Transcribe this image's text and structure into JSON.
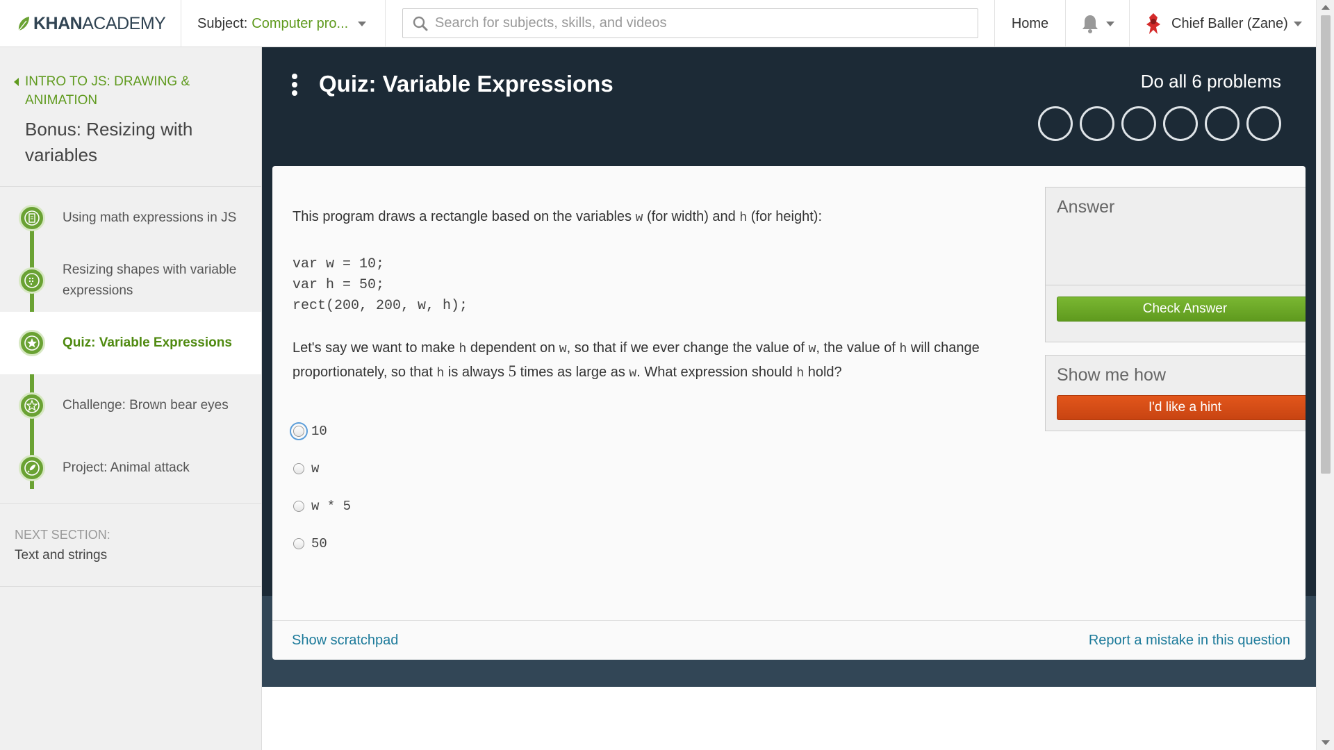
{
  "topbar": {
    "logo_bold": "KHAN",
    "logo_light": "ACADEMY",
    "subject_label": "Subject:",
    "subject_value": "Computer pro...",
    "search_placeholder": "Search for subjects, skills, and videos",
    "home": "Home",
    "user_name": "Chief Baller (Zane)"
  },
  "sidebar": {
    "back_label": "INTRO TO JS: DRAWING & ANIMATION",
    "tutorial_title": "Bonus: Resizing with variables",
    "steps": [
      {
        "label": "Using math expressions in JS",
        "icon": "article-icon"
      },
      {
        "label": "Resizing shapes with variable expressions",
        "icon": "talkthrough-icon"
      },
      {
        "label": "Quiz: Variable Expressions",
        "icon": "star-icon",
        "active": true
      },
      {
        "label": "Challenge: Brown bear eyes",
        "icon": "challenge-star-icon"
      },
      {
        "label": "Project: Animal attack",
        "icon": "rocket-icon"
      }
    ],
    "next_section_label": "NEXT SECTION:",
    "next_section_value": "Text and strings"
  },
  "quiz": {
    "title": "Quiz: Variable Expressions",
    "progress_text": "Do all 6 problems",
    "problems_total": 6,
    "problems_completed": 0,
    "intro_1": "This program draws a rectangle based on the variables ",
    "intro_w": "w",
    "intro_2": " (for width) and ",
    "intro_h": "h",
    "intro_3": " (for height):",
    "code_lines": [
      "var w = 10;",
      "var h = 50;",
      "rect(200, 200, w, h);"
    ],
    "question": {
      "p1": "Let's say we want to make ",
      "c1": "h",
      "p2": " dependent on ",
      "c2": "w",
      "p3": ", so that if we ever change the value of ",
      "c3": "w",
      "p4": ", the value of ",
      "c4": "h",
      "p5": " will change proportionately, so that ",
      "c5": "h",
      "p6": " is always ",
      "n": "5",
      "p7": " times as large as ",
      "c6": "w",
      "p8": ". What expression should ",
      "c7": "h",
      "p9": " hold?"
    },
    "choices": [
      "10",
      "w",
      "w * 5",
      "50"
    ],
    "show_scratchpad": "Show scratchpad",
    "report_mistake": "Report a mistake in this question"
  },
  "answer_panel": {
    "title": "Answer",
    "check_button": "Check Answer",
    "hint_title": "Show me how",
    "hint_button": "I'd like a hint"
  },
  "colors": {
    "brand_green": "#5f9a1e",
    "header_dark": "#1c2a36",
    "hint_orange": "#d24e17",
    "link_blue": "#1c7a9a"
  }
}
